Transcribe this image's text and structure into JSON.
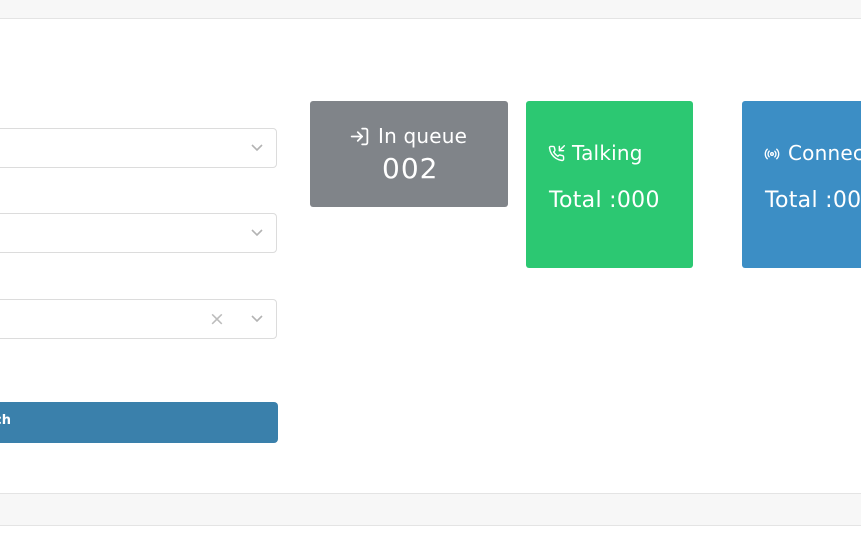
{
  "filters": {
    "select1_value": "",
    "select2_value": "",
    "select3_value": "",
    "clear_symbol": "×",
    "search_label": "ch"
  },
  "cards": {
    "queue": {
      "title": "In queue",
      "value": "002",
      "color": "#808489",
      "icon": "sign-in-icon"
    },
    "talking": {
      "title": "Talking",
      "total": "Total :000",
      "color": "#2cc872",
      "icon": "phone-incoming-icon"
    },
    "connected": {
      "title": "Connec",
      "total": "Total :00",
      "color": "#3c8ec5",
      "icon": "broadcast-icon"
    }
  },
  "colors": {
    "search_button": "#3a80ab"
  }
}
